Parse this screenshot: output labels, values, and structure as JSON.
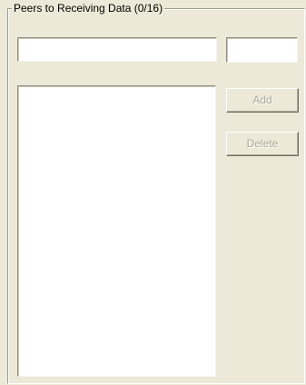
{
  "group": {
    "title": "Peers to Receiving Data (0/16)"
  },
  "peer_input": {
    "value": "",
    "placeholder": ""
  },
  "port_input": {
    "value": "",
    "placeholder": ""
  },
  "peer_list": {
    "items": []
  },
  "buttons": {
    "add_label": "Add",
    "delete_label": "Delete",
    "add_enabled": false,
    "delete_enabled": false
  }
}
